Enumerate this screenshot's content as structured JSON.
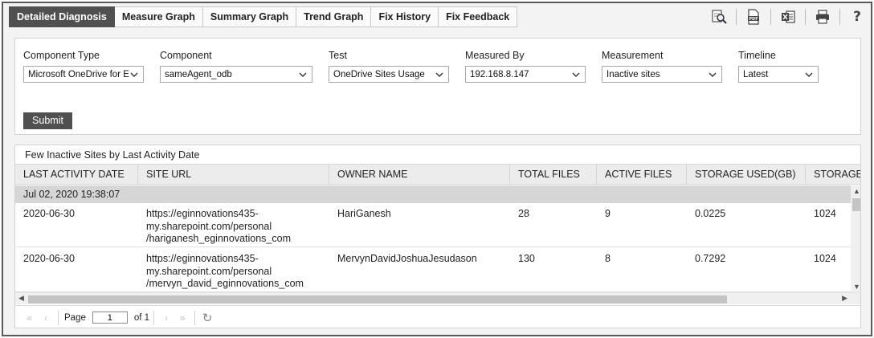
{
  "tabs": [
    {
      "label": "Detailed Diagnosis",
      "active": true
    },
    {
      "label": "Measure Graph"
    },
    {
      "label": "Summary Graph"
    },
    {
      "label": "Trend Graph"
    },
    {
      "label": "Fix History"
    },
    {
      "label": "Fix Feedback"
    }
  ],
  "toolbar": {
    "icons": [
      "search-icon",
      "pdf-icon",
      "excel-icon",
      "print-icon",
      "help-icon"
    ],
    "pdf_text": "PDF",
    "help_text": "?"
  },
  "filters": {
    "component_type": {
      "label": "Component Type",
      "value": "Microsoft OneDrive for E"
    },
    "component": {
      "label": "Component",
      "value": "sameAgent_odb"
    },
    "test": {
      "label": "Test",
      "value": "OneDrive Sites Usage"
    },
    "measured_by": {
      "label": "Measured By",
      "value": "192.168.8.147"
    },
    "measurement": {
      "label": "Measurement",
      "value": "Inactive sites"
    },
    "timeline": {
      "label": "Timeline",
      "value": "Latest"
    },
    "submit_label": "Submit"
  },
  "table": {
    "title": "Few Inactive Sites by Last Activity Date",
    "columns": [
      "LAST ACTIVITY DATE",
      "SITE URL",
      "OWNER NAME",
      "TOTAL FILES",
      "ACTIVE FILES",
      "STORAGE USED(GB)",
      "STORAGE A"
    ],
    "group_label": "Jul 02, 2020 19:38:07",
    "rows": [
      [
        "2020-06-30",
        "https://eginnovations435-\nmy.sharepoint.com/personal\n/hariganesh_eginnovations_com",
        "HariGanesh",
        "28",
        "9",
        "0.0225",
        "1024"
      ],
      [
        "2020-06-30",
        "https://eginnovations435-\nmy.sharepoint.com/personal\n/mervyn_david_eginnovations_com",
        "MervynDavidJoshuaJesudason",
        "130",
        "8",
        "0.7292",
        "1024"
      ]
    ]
  },
  "pager": {
    "page_label": "Page",
    "page_value": "1",
    "of_label": "of 1"
  }
}
